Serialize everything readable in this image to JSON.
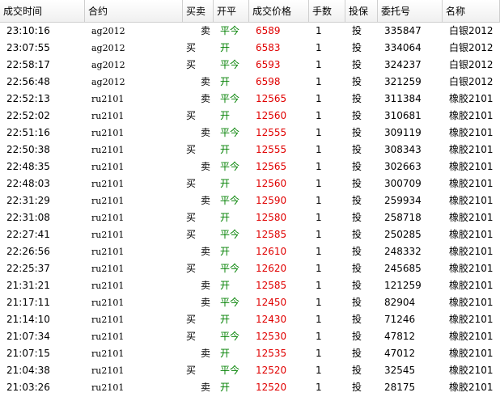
{
  "headers": {
    "time": "成交时间",
    "contract": "合约",
    "side": "买卖",
    "open_close": "开平",
    "price": "成交价格",
    "qty": "手数",
    "hedge": "投保",
    "order_no": "委托号",
    "name": "名称"
  },
  "rows": [
    {
      "time": "23:10:16",
      "contract": "ag2012",
      "side": "卖",
      "open_close": "平今",
      "price": "6589",
      "qty": "1",
      "hedge": "投",
      "order_no": "335847",
      "name": "白银2012"
    },
    {
      "time": "23:07:55",
      "contract": "ag2012",
      "side": "买",
      "open_close": "开",
      "price": "6583",
      "qty": "1",
      "hedge": "投",
      "order_no": "334064",
      "name": "白银2012"
    },
    {
      "time": "22:58:17",
      "contract": "ag2012",
      "side": "买",
      "open_close": "平今",
      "price": "6593",
      "qty": "1",
      "hedge": "投",
      "order_no": "324237",
      "name": "白银2012"
    },
    {
      "time": "22:56:48",
      "contract": "ag2012",
      "side": "卖",
      "open_close": "开",
      "price": "6598",
      "qty": "1",
      "hedge": "投",
      "order_no": "321259",
      "name": "白银2012"
    },
    {
      "time": "22:52:13",
      "contract": "ru2101",
      "side": "卖",
      "open_close": "平今",
      "price": "12565",
      "qty": "1",
      "hedge": "投",
      "order_no": "311384",
      "name": "橡胶2101"
    },
    {
      "time": "22:52:02",
      "contract": "ru2101",
      "side": "买",
      "open_close": "开",
      "price": "12560",
      "qty": "1",
      "hedge": "投",
      "order_no": "310681",
      "name": "橡胶2101"
    },
    {
      "time": "22:51:16",
      "contract": "ru2101",
      "side": "卖",
      "open_close": "平今",
      "price": "12555",
      "qty": "1",
      "hedge": "投",
      "order_no": "309119",
      "name": "橡胶2101"
    },
    {
      "time": "22:50:38",
      "contract": "ru2101",
      "side": "买",
      "open_close": "开",
      "price": "12555",
      "qty": "1",
      "hedge": "投",
      "order_no": "308343",
      "name": "橡胶2101"
    },
    {
      "time": "22:48:35",
      "contract": "ru2101",
      "side": "卖",
      "open_close": "平今",
      "price": "12565",
      "qty": "1",
      "hedge": "投",
      "order_no": "302663",
      "name": "橡胶2101"
    },
    {
      "time": "22:48:03",
      "contract": "ru2101",
      "side": "买",
      "open_close": "开",
      "price": "12560",
      "qty": "1",
      "hedge": "投",
      "order_no": "300709",
      "name": "橡胶2101"
    },
    {
      "time": "22:31:29",
      "contract": "ru2101",
      "side": "卖",
      "open_close": "平今",
      "price": "12590",
      "qty": "1",
      "hedge": "投",
      "order_no": "259934",
      "name": "橡胶2101"
    },
    {
      "time": "22:31:08",
      "contract": "ru2101",
      "side": "买",
      "open_close": "开",
      "price": "12580",
      "qty": "1",
      "hedge": "投",
      "order_no": "258718",
      "name": "橡胶2101"
    },
    {
      "time": "22:27:41",
      "contract": "ru2101",
      "side": "买",
      "open_close": "平今",
      "price": "12585",
      "qty": "1",
      "hedge": "投",
      "order_no": "250285",
      "name": "橡胶2101"
    },
    {
      "time": "22:26:56",
      "contract": "ru2101",
      "side": "卖",
      "open_close": "开",
      "price": "12610",
      "qty": "1",
      "hedge": "投",
      "order_no": "248332",
      "name": "橡胶2101"
    },
    {
      "time": "22:25:37",
      "contract": "ru2101",
      "side": "买",
      "open_close": "平今",
      "price": "12620",
      "qty": "1",
      "hedge": "投",
      "order_no": "245685",
      "name": "橡胶2101"
    },
    {
      "time": "21:31:21",
      "contract": "ru2101",
      "side": "卖",
      "open_close": "开",
      "price": "12585",
      "qty": "1",
      "hedge": "投",
      "order_no": "121259",
      "name": "橡胶2101"
    },
    {
      "time": "21:17:11",
      "contract": "ru2101",
      "side": "卖",
      "open_close": "平今",
      "price": "12450",
      "qty": "1",
      "hedge": "投",
      "order_no": "82904",
      "name": "橡胶2101"
    },
    {
      "time": "21:14:10",
      "contract": "ru2101",
      "side": "买",
      "open_close": "开",
      "price": "12430",
      "qty": "1",
      "hedge": "投",
      "order_no": "71246",
      "name": "橡胶2101"
    },
    {
      "time": "21:07:34",
      "contract": "ru2101",
      "side": "买",
      "open_close": "平今",
      "price": "12530",
      "qty": "1",
      "hedge": "投",
      "order_no": "47812",
      "name": "橡胶2101"
    },
    {
      "time": "21:07:15",
      "contract": "ru2101",
      "side": "卖",
      "open_close": "开",
      "price": "12535",
      "qty": "1",
      "hedge": "投",
      "order_no": "47012",
      "name": "橡胶2101"
    },
    {
      "time": "21:04:38",
      "contract": "ru2101",
      "side": "买",
      "open_close": "平今",
      "price": "12520",
      "qty": "1",
      "hedge": "投",
      "order_no": "32545",
      "name": "橡胶2101"
    },
    {
      "time": "21:03:26",
      "contract": "ru2101",
      "side": "卖",
      "open_close": "开",
      "price": "12520",
      "qty": "1",
      "hedge": "投",
      "order_no": "28175",
      "name": "橡胶2101"
    }
  ],
  "colors": {
    "open_close": "#008000",
    "price": "#e00000"
  }
}
